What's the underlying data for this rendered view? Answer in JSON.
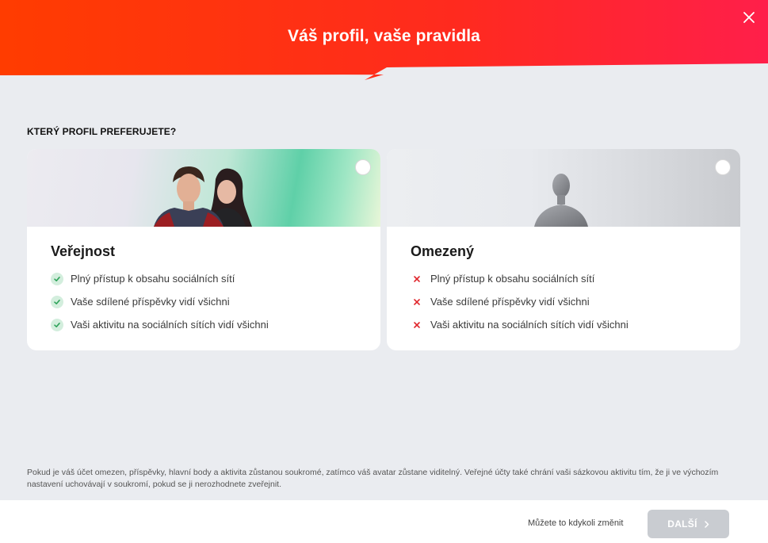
{
  "header": {
    "title": "Váš profil, vaše pravidla",
    "gradient_start": "#ff3c00",
    "gradient_end": "#ff1f4a"
  },
  "question": "KTERÝ PROFIL PREFERUJETE?",
  "options": [
    {
      "title": "Veřejnost",
      "selected": false,
      "features": [
        {
          "icon": "check-icon",
          "text": "Plný přístup k obsahu sociálních sítí"
        },
        {
          "icon": "check-icon",
          "text": "Vaše sdílené příspěvky vidí všichni"
        },
        {
          "icon": "check-icon",
          "text": "Vaši aktivitu na sociálních sítích vidí všichni"
        }
      ]
    },
    {
      "title": "Omezený",
      "selected": false,
      "features": [
        {
          "icon": "cross-icon",
          "text": "Plný přístup k obsahu sociálních sítí"
        },
        {
          "icon": "cross-icon",
          "text": "Vaše sdílené příspěvky vidí všichni"
        },
        {
          "icon": "cross-icon",
          "text": "Vaši aktivitu na sociálních sítích vidí všichni"
        }
      ]
    }
  ],
  "footnote": "Pokud je váš účet omezen, příspěvky, hlavní body a aktivita zůstanou soukromé, zatímco váš avatar zůstane viditelný. Veřejné účty také chrání vaši sázkovou aktivitu tím, že ji ve výchozím nastavení uchovávají v soukromí, pokud se ji nerozhodnete zveřejnit.",
  "footer": {
    "hint": "Můžete to kdykoli změnit",
    "next_label": "DALŠÍ"
  },
  "colors": {
    "check": "#2fa35a",
    "cross": "#e0282e",
    "button_disabled": "#c9ccd1"
  }
}
